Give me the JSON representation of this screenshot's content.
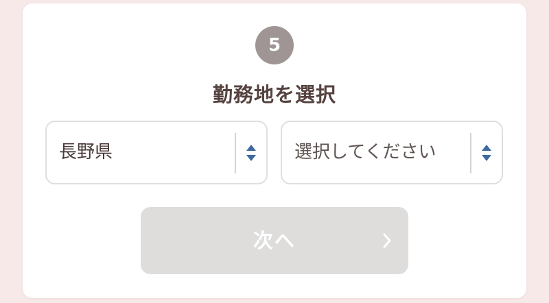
{
  "step": {
    "number": "5"
  },
  "title": {
    "emphasis": "勤務地",
    "rest": "を選択"
  },
  "prefecture_select": {
    "value": "長野県",
    "icon": "up-down-arrows-icon"
  },
  "city_select": {
    "placeholder": "選択してください",
    "icon": "up-down-arrows-icon"
  },
  "next_button": {
    "label": "次へ",
    "icon": "chevron-right-icon",
    "disabled": true
  },
  "colors": {
    "page_background": "#f8e9e9",
    "card_background": "#ffffff",
    "badge": "#9f9595",
    "title_text": "#55423f",
    "select_arrow": "#3f6aa0",
    "button_disabled": "#dedddc"
  }
}
